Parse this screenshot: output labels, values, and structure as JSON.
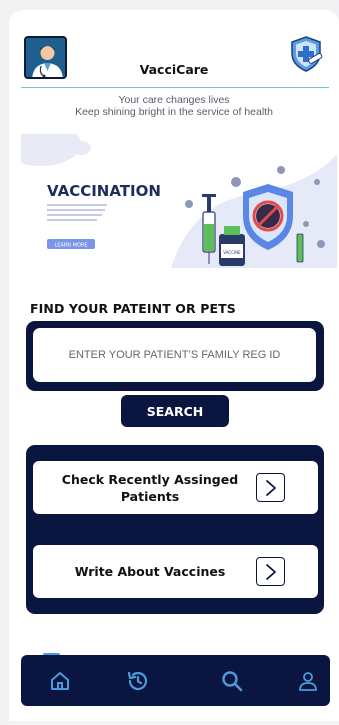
{
  "header": {
    "app_title": "VacciCare",
    "tagline_1": "Your care changes lives",
    "tagline_2": "Keep shining bright in the service of health"
  },
  "banner": {
    "title": "VACCINATION",
    "button_label": "LEARN MORE",
    "vial_label": "VACCINE"
  },
  "find": {
    "title": "FIND YOUR PATEINT OR PETS",
    "placeholder": "ENTER YOUR PATIENT’S FAMILY REG ID",
    "search_label": "SEARCH"
  },
  "actions": [
    {
      "label": "Check Recently Assinged Patients"
    },
    {
      "label": "Write About Vaccines"
    }
  ],
  "nav": {
    "items": [
      "home-icon",
      "history-icon",
      "search-icon",
      "profile-icon"
    ],
    "active": "home-icon"
  },
  "colors": {
    "navy": "#0b1640",
    "accent_line": "#6fc5cf",
    "nav_icon": "#4d9bdc"
  }
}
